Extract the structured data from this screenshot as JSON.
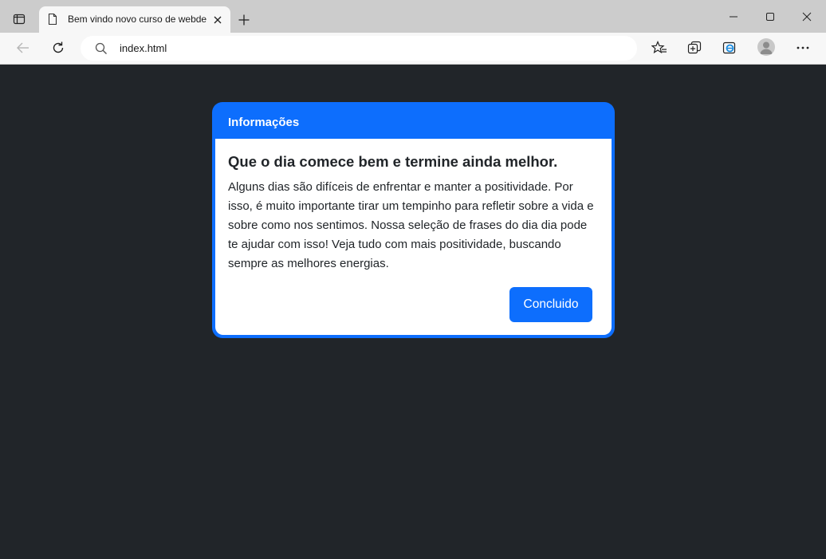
{
  "browser": {
    "tab": {
      "title": "Bem vindo novo curso de webdesign"
    },
    "address_bar": {
      "url": "index.html"
    }
  },
  "card": {
    "header": "Informações",
    "title": "Que o dia comece bem e termine ainda melhor.",
    "text": "Alguns dias são difíceis de enfrentar e manter a positividade. Por isso, é muito importante tirar um tempinho para refletir sobre a vida e sobre como nos sentimos. Nossa seleção de frases do dia dia pode te ajudar com isso! Veja tudo com mais positividade, buscando sempre as melhores energias.",
    "button_label": "Concluido"
  },
  "colors": {
    "page_background": "#212529",
    "primary": "#0d6efd",
    "tabstrip": "#cccccc",
    "toolbar": "#f7f7f7"
  },
  "icons": [
    "tab-actions-icon",
    "page-icon",
    "close-icon",
    "plus-icon",
    "minimize-icon",
    "maximize-icon",
    "window-close-icon",
    "back-arrow-icon",
    "refresh-icon",
    "search-icon",
    "favorites-icon",
    "collections-icon",
    "edge-icon",
    "avatar-icon",
    "more-icon"
  ]
}
